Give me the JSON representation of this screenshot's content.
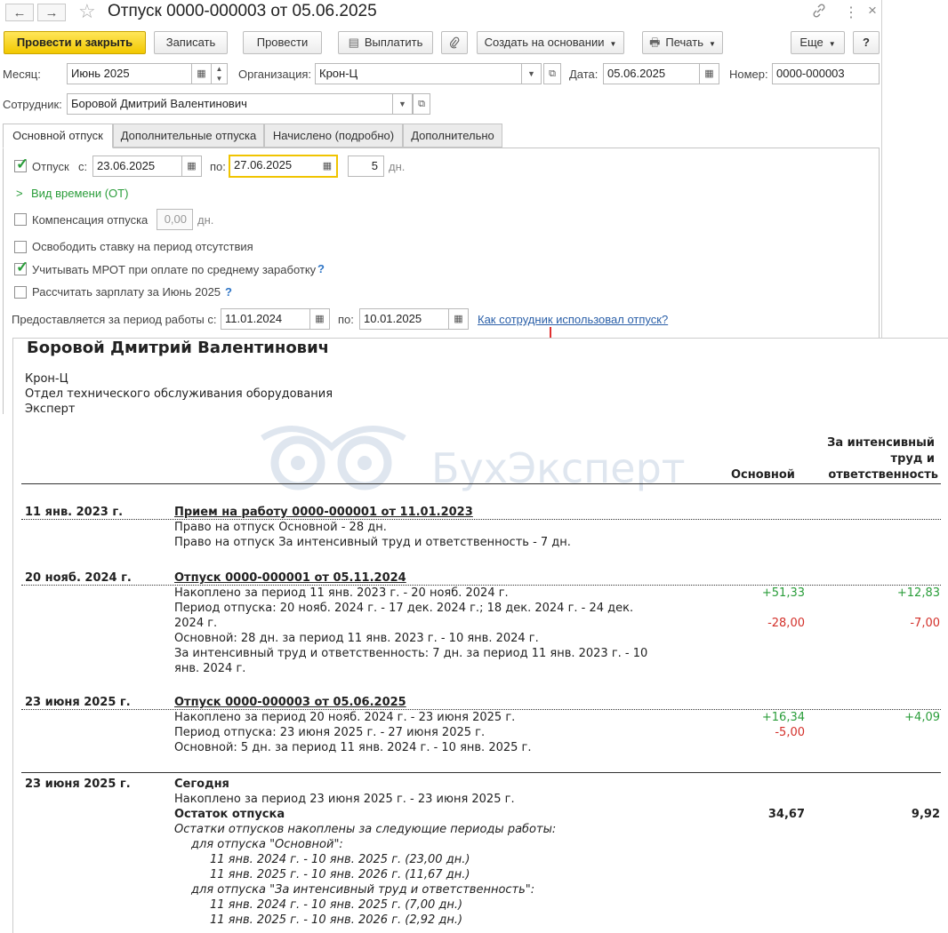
{
  "window": {
    "title": "Отпуск 0000-000003 от 05.06.2025",
    "back_icon": "←",
    "forward_icon": "→",
    "star_icon": "☆",
    "link_icon": "🔗",
    "more_icon": "⋮",
    "close_icon": "×"
  },
  "toolbar": {
    "post_close": "Провести и закрыть",
    "save": "Записать",
    "post": "Провести",
    "pay": "Выплатить",
    "clip_icon": "📎",
    "create_based": "Создать на основании",
    "print": "Печать",
    "more": "Еще",
    "help": "?"
  },
  "header": {
    "month_label": "Месяц:",
    "month_value": "Июнь 2025",
    "org_label": "Организация:",
    "org_value": "Крон-Ц",
    "date_label": "Дата:",
    "date_value": "05.06.2025",
    "number_label": "Номер:",
    "number_value": "0000-000003",
    "employee_label": "Сотрудник:",
    "employee_value": "Боровой Дмитрий Валентинович"
  },
  "tabs": [
    {
      "label": "Основной отпуск",
      "active": true
    },
    {
      "label": "Дополнительные отпуска",
      "active": false
    },
    {
      "label": "Начислено (подробно)",
      "active": false
    },
    {
      "label": "Дополнительно",
      "active": false
    }
  ],
  "form": {
    "vacation_label": "Отпуск",
    "vacation_checked": true,
    "from_label": "с:",
    "from_value": "23.06.2025",
    "to_label": "по:",
    "to_value": "27.06.2025",
    "days_value": "5",
    "days_label": "дн.",
    "time_kind": "Вид времени (ОТ)",
    "compensation_label": "Компенсация отпуска",
    "compensation_checked": false,
    "compensation_value": "0,00",
    "compensation_days_label": "дн.",
    "free_rate_label": "Освободить ставку на период отсутствия",
    "free_rate_checked": false,
    "mrot_label": "Учитывать МРОТ при оплате по среднему заработку",
    "mrot_checked": true,
    "calc_salary_label": "Рассчитать зарплату за Июнь 2025",
    "calc_salary_checked": false,
    "period_label": "Предоставляется за период работы с:",
    "period_from": "11.01.2024",
    "period_to_label": "по:",
    "period_to": "10.01.2025",
    "used_link": "Как сотрудник использовал отпуск?",
    "help_q": "?"
  },
  "report": {
    "employee": "Боровой Дмитрий Валентинович",
    "org": "Крон-Ц",
    "department": "Отдел технического обслуживания оборудования",
    "position": "Эксперт",
    "watermark": "БухЭксперт",
    "col_main": "Основной",
    "col_extra_1": "За интенсивный",
    "col_extra_2": "труд и",
    "col_extra_3": "ответственность",
    "s1": {
      "date": "11 янв. 2023 г.",
      "title": "Прием на работу 0000-000001 от 11.01.2023",
      "l1": "Право на отпуск Основной - 28 дн.",
      "l2": "Право на отпуск За интенсивный труд и ответственность - 7 дн."
    },
    "s2": {
      "date": "20 нояб. 2024 г.",
      "title": "Отпуск 0000-000001 от 05.11.2024",
      "l1": "Накоплено за период 11 янв. 2023 г. - 20 нояб. 2024 г.",
      "l1_main": "+51,33",
      "l1_extra": "+12,83",
      "l2": "Период отпуска: 20 нояб. 2024 г. - 17 дек. 2024 г.; 18 дек. 2024 г. - 24 дек.",
      "l2b": "2024 г.",
      "l2_main": "-28,00",
      "l2_extra": "-7,00",
      "l3": "Основной: 28 дн. за период 11 янв. 2023 г. - 10 янв. 2024 г.",
      "l4": "За интенсивный труд и ответственность: 7 дн. за период 11 янв. 2023 г. - 10",
      "l4b": "янв. 2024 г."
    },
    "s3": {
      "date": "23 июня 2025 г.",
      "title": "Отпуск 0000-000003 от 05.06.2025",
      "l1": "Накоплено за период 20 нояб. 2024 г. - 23 июня 2025 г.",
      "l1_main": "+16,34",
      "l1_extra": "+4,09",
      "l2": "Период отпуска: 23 июня 2025 г. - 27 июня 2025 г.",
      "l2_main": "-5,00",
      "l3": "Основной: 5 дн. за период 11 янв. 2024 г. - 10 янв. 2025 г."
    },
    "s4": {
      "date": "23 июня 2025 г.",
      "title": "Сегодня",
      "l1": "Накоплено за период 23 июня 2025 г. - 23 июня 2025 г.",
      "l2": "Остаток отпуска",
      "l2_main": "34,67",
      "l2_extra": "9,92",
      "l3": "Остатки отпусков накоплены за следующие периоды работы:",
      "l4": "для отпуска \"Основной\":",
      "l5": "11 янв. 2024 г. - 10 янв. 2025 г. (23,00 дн.)",
      "l6": "11 янв. 2025 г. - 10 янв. 2026 г. (11,67 дн.)",
      "l7": "для отпуска \"За интенсивный труд и ответственность\":",
      "l8": "11 янв. 2024 г. - 10 янв. 2025 г. (7,00 дн.)",
      "l9": "11 янв. 2025 г. - 10 янв. 2026 г. (2,92 дн.)"
    }
  }
}
